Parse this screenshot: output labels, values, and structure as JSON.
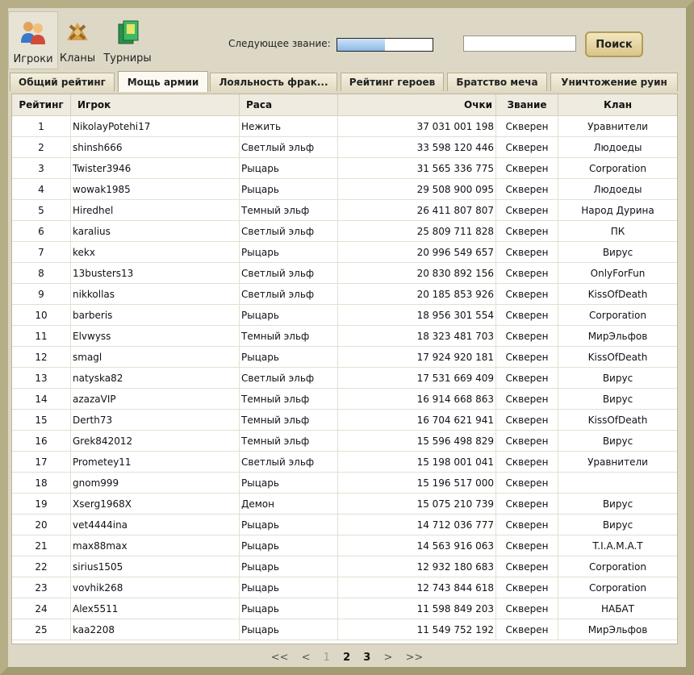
{
  "nav": {
    "players": "Игроки",
    "clans": "Кланы",
    "tournaments": "Турниры"
  },
  "rank": {
    "label": "Следующее звание:",
    "progress": 0.5
  },
  "search": {
    "value": "",
    "button": "Поиск"
  },
  "tabs": [
    "Общий рейтинг",
    "Мощь армии",
    "Лояльность фрак...",
    "Рейтинг героев",
    "Братство меча",
    "Уничтожение руин"
  ],
  "active_tab": 1,
  "table": {
    "headers": [
      "Рейтинг",
      "Игрок",
      "Раса",
      "Очки",
      "Звание",
      "Клан"
    ],
    "rows": [
      [
        "1",
        "NikolayPotehi17",
        "Нежить",
        "37 031 001 198",
        "Скверен",
        "Уравнители"
      ],
      [
        "2",
        "shinsh666",
        "Светлый эльф",
        "33 598 120 446",
        "Скверен",
        "Людоеды"
      ],
      [
        "3",
        "Twister3946",
        "Рыцарь",
        "31 565 336 775",
        "Скверен",
        "Corporation"
      ],
      [
        "4",
        "wowak1985",
        "Рыцарь",
        "29 508 900 095",
        "Скверен",
        "Людоеды"
      ],
      [
        "5",
        "Hiredhel",
        "Темный эльф",
        "26 411 807 807",
        "Скверен",
        "Народ Дурина"
      ],
      [
        "6",
        "karalius",
        "Светлый эльф",
        "25 809 711 828",
        "Скверен",
        "ПК"
      ],
      [
        "7",
        "kekx",
        "Рыцарь",
        "20 996 549 657",
        "Скверен",
        "Вирус"
      ],
      [
        "8",
        "13busters13",
        "Светлый эльф",
        "20 830 892 156",
        "Скверен",
        "OnlyForFun"
      ],
      [
        "9",
        "nikkollas",
        "Светлый эльф",
        "20 185 853 926",
        "Скверен",
        "KissOfDeath"
      ],
      [
        "10",
        "barberis",
        "Рыцарь",
        "18 956 301 554",
        "Скверен",
        "Corporation"
      ],
      [
        "11",
        "Elvwyss",
        "Темный эльф",
        "18 323 481 703",
        "Скверен",
        "МирЭльфов"
      ],
      [
        "12",
        "smagl",
        "Рыцарь",
        "17 924 920 181",
        "Скверен",
        "KissOfDeath"
      ],
      [
        "13",
        "natyska82",
        "Светлый эльф",
        "17 531 669 409",
        "Скверен",
        "Вирус"
      ],
      [
        "14",
        "azazaVIP",
        "Темный эльф",
        "16 914 668 863",
        "Скверен",
        "Вирус"
      ],
      [
        "15",
        "Derth73",
        "Темный эльф",
        "16 704 621 941",
        "Скверен",
        "KissOfDeath"
      ],
      [
        "16",
        "Grek842012",
        "Темный эльф",
        "15 596 498 829",
        "Скверен",
        "Вирус"
      ],
      [
        "17",
        "Prometey11",
        "Светлый эльф",
        "15 198 001 041",
        "Скверен",
        "Уравнители"
      ],
      [
        "18",
        "gnom999",
        "Рыцарь",
        "15 196 517 000",
        "Скверен",
        ""
      ],
      [
        "19",
        "Xserg1968X",
        "Демон",
        "15 075 210 739",
        "Скверен",
        "Вирус"
      ],
      [
        "20",
        "vet4444ina",
        "Рыцарь",
        "14 712 036 777",
        "Скверен",
        "Вирус"
      ],
      [
        "21",
        "max88max",
        "Рыцарь",
        "14 563 916 063",
        "Скверен",
        "T.I.A.M.A.T"
      ],
      [
        "22",
        "sirius1505",
        "Рыцарь",
        "12 932 180 683",
        "Скверен",
        "Corporation"
      ],
      [
        "23",
        "vovhik268",
        "Рыцарь",
        "12 743 844 618",
        "Скверен",
        "Corporation"
      ],
      [
        "24",
        "Alex5511",
        "Рыцарь",
        "11 598 849 203",
        "Скверен",
        "НАБАТ"
      ],
      [
        "25",
        "kaa2208",
        "Рыцарь",
        "11 549 752 192",
        "Скверен",
        "МирЭльфов"
      ]
    ]
  },
  "pager": {
    "first": "<<",
    "prev": "<",
    "pages": [
      "1",
      "2",
      "3"
    ],
    "current": "1",
    "next": ">",
    "last": ">>"
  },
  "colors": {
    "progress_fill": "#8cb9e6",
    "frame": "#a39b72"
  }
}
